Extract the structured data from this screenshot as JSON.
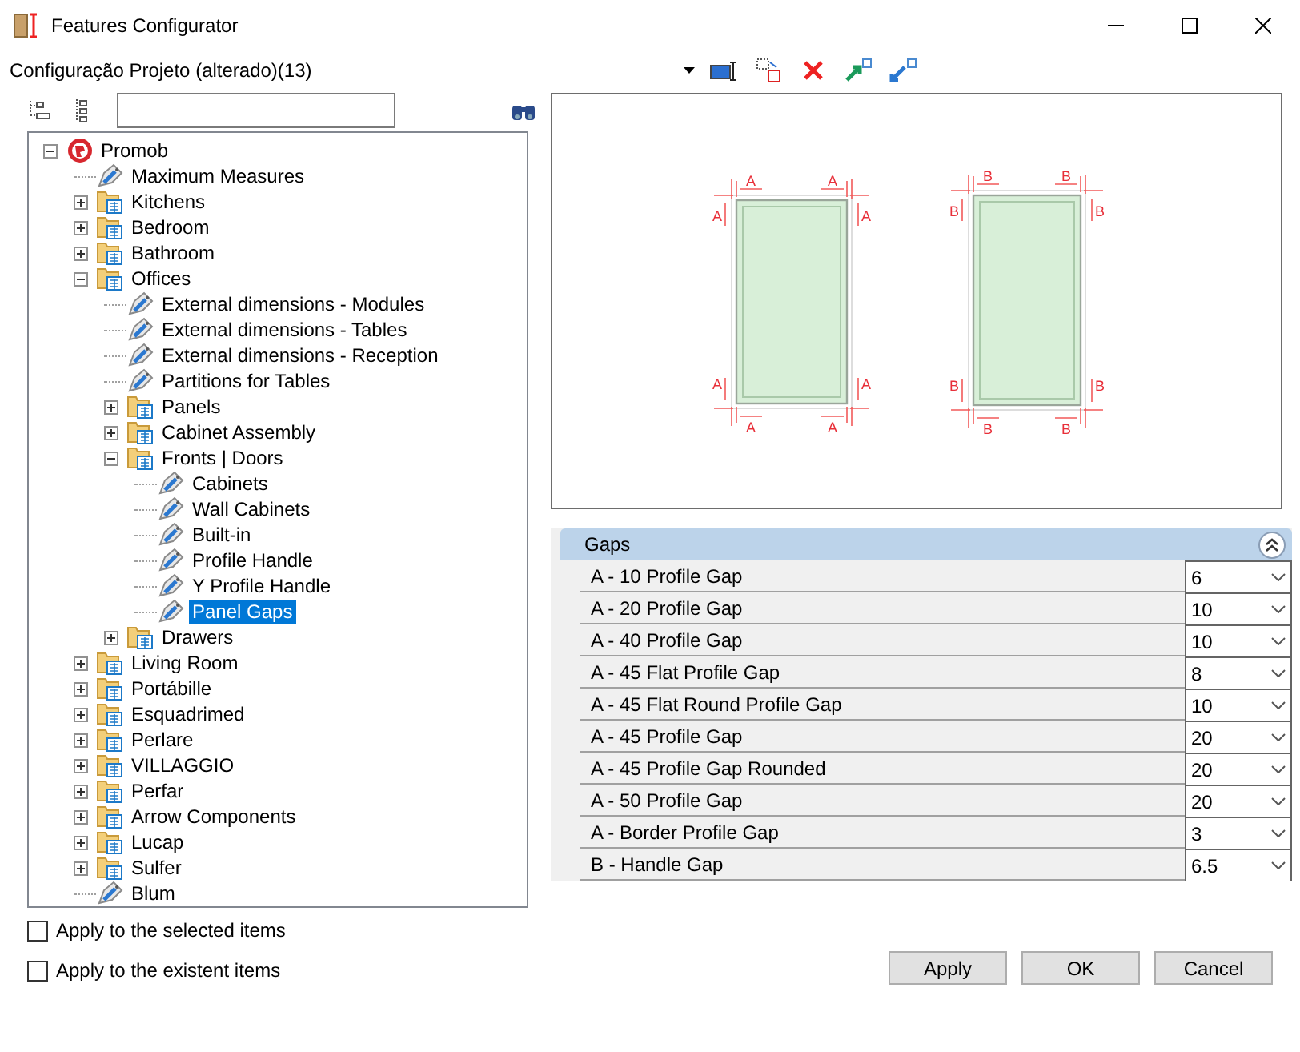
{
  "window": {
    "title": "Features Configurator"
  },
  "toolbar": {
    "configuration": "Configuração Projeto (alterado)(13)"
  },
  "tree": [
    {
      "label": "Promob",
      "kind": "root",
      "expanded": true,
      "selected": false,
      "children": [
        {
          "label": "Maximum Measures",
          "kind": "feature",
          "selected": false
        },
        {
          "label": "Kitchens",
          "kind": "folder",
          "expanded": false,
          "selected": false
        },
        {
          "label": "Bedroom",
          "kind": "folder",
          "expanded": false,
          "selected": false
        },
        {
          "label": "Bathroom",
          "kind": "folder",
          "expanded": false,
          "selected": false
        },
        {
          "label": "Offices",
          "kind": "folder",
          "expanded": true,
          "selected": false,
          "children": [
            {
              "label": "External dimensions - Modules",
              "kind": "feature",
              "selected": false
            },
            {
              "label": "External dimensions - Tables",
              "kind": "feature",
              "selected": false
            },
            {
              "label": "External dimensions - Reception",
              "kind": "feature",
              "selected": false
            },
            {
              "label": "Partitions for Tables",
              "kind": "feature",
              "selected": false
            },
            {
              "label": "Panels",
              "kind": "folder",
              "expanded": false,
              "selected": false
            },
            {
              "label": "Cabinet Assembly",
              "kind": "folder",
              "expanded": false,
              "selected": false
            },
            {
              "label": "Fronts | Doors",
              "kind": "folder",
              "expanded": true,
              "selected": false,
              "children": [
                {
                  "label": "Cabinets",
                  "kind": "feature",
                  "selected": false
                },
                {
                  "label": "Wall Cabinets",
                  "kind": "feature",
                  "selected": false
                },
                {
                  "label": "Built-in",
                  "kind": "feature",
                  "selected": false
                },
                {
                  "label": "Profile Handle",
                  "kind": "feature",
                  "selected": false
                },
                {
                  "label": "Y Profile Handle",
                  "kind": "feature",
                  "selected": false
                },
                {
                  "label": "Panel Gaps",
                  "kind": "feature",
                  "selected": true
                }
              ]
            },
            {
              "label": "Drawers",
              "kind": "folder",
              "expanded": false,
              "selected": false
            }
          ]
        },
        {
          "label": "Living Room",
          "kind": "folder",
          "expanded": false,
          "selected": false
        },
        {
          "label": "Portábille",
          "kind": "folder",
          "expanded": false,
          "selected": false
        },
        {
          "label": "Esquadrimed",
          "kind": "folder",
          "expanded": false,
          "selected": false
        },
        {
          "label": "Perlare",
          "kind": "folder",
          "expanded": false,
          "selected": false
        },
        {
          "label": "VILLAGGIO",
          "kind": "folder",
          "expanded": false,
          "selected": false
        },
        {
          "label": "Perfar",
          "kind": "folder",
          "expanded": false,
          "selected": false
        },
        {
          "label": "Arrow Components",
          "kind": "folder",
          "expanded": false,
          "selected": false
        },
        {
          "label": "Lucap",
          "kind": "folder",
          "expanded": false,
          "selected": false
        },
        {
          "label": "Sulfer",
          "kind": "folder",
          "expanded": false,
          "selected": false
        },
        {
          "label": "Blum",
          "kind": "feature",
          "selected": false
        }
      ]
    }
  ],
  "preview": {
    "doors": [
      {
        "labels": [
          "A",
          "A",
          "A",
          "A",
          "A",
          "A",
          "A",
          "A"
        ]
      },
      {
        "labels": [
          "B",
          "B",
          "B",
          "B",
          "B",
          "B",
          "B",
          "B"
        ]
      }
    ]
  },
  "properties": {
    "group": "Gaps",
    "expanded": true,
    "rows": [
      {
        "name": "A - 10 Profile Gap",
        "value": "6"
      },
      {
        "name": "A - 20 Profile Gap",
        "value": "10"
      },
      {
        "name": "A - 40 Profile Gap",
        "value": "10"
      },
      {
        "name": "A - 45 Flat Profile Gap",
        "value": "8"
      },
      {
        "name": "A - 45 Flat Round Profile Gap",
        "value": "10"
      },
      {
        "name": "A - 45 Profile Gap",
        "value": "20"
      },
      {
        "name": "A - 45 Profile Gap Rounded",
        "value": "20"
      },
      {
        "name": "A - 50 Profile Gap",
        "value": "20"
      },
      {
        "name": "A - Border Profile Gap",
        "value": "3"
      },
      {
        "name": "B - Handle Gap",
        "value": "6.5"
      }
    ]
  },
  "options": [
    {
      "label": "Apply to the selected items",
      "checked": false
    },
    {
      "label": "Apply to the existent items",
      "checked": false
    }
  ],
  "buttons": [
    "Apply",
    "OK",
    "Cancel"
  ]
}
